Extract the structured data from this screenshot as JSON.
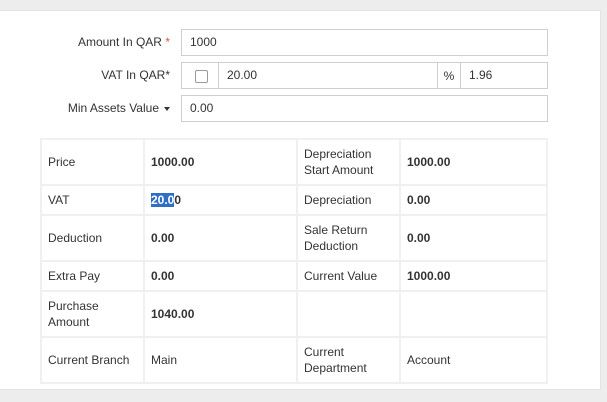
{
  "form": {
    "amount": {
      "label": "Amount In QAR",
      "required_mark": "*",
      "value": "1000"
    },
    "vat": {
      "label": "VAT In QAR*",
      "value": "20.00",
      "percent_sign": "%",
      "percent_value": "1.96"
    },
    "min_assets": {
      "label": "Min Assets Value",
      "value": "0.00"
    }
  },
  "grid": {
    "rows": [
      {
        "l1": "Price",
        "v1": "1000.00",
        "l2": "Depreciation Start Amount",
        "v2": "1000.00"
      },
      {
        "l1": "VAT",
        "v1_selected": "20.0",
        "v1_rest": "0",
        "l2": "Depreciation",
        "v2": "0.00"
      },
      {
        "l1": "Deduction",
        "v1": "0.00",
        "l2": "Sale Return Deduction",
        "v2": "0.00"
      },
      {
        "l1": "Extra Pay",
        "v1": "0.00",
        "l2": "Current Value",
        "v2": "1000.00"
      },
      {
        "l1": "Purchase Amount",
        "v1": "1040.00",
        "l2": "",
        "v2": ""
      },
      {
        "l1": "Current Branch",
        "v1": "Main",
        "l2": "Current Department",
        "v2": "Account"
      }
    ]
  }
}
